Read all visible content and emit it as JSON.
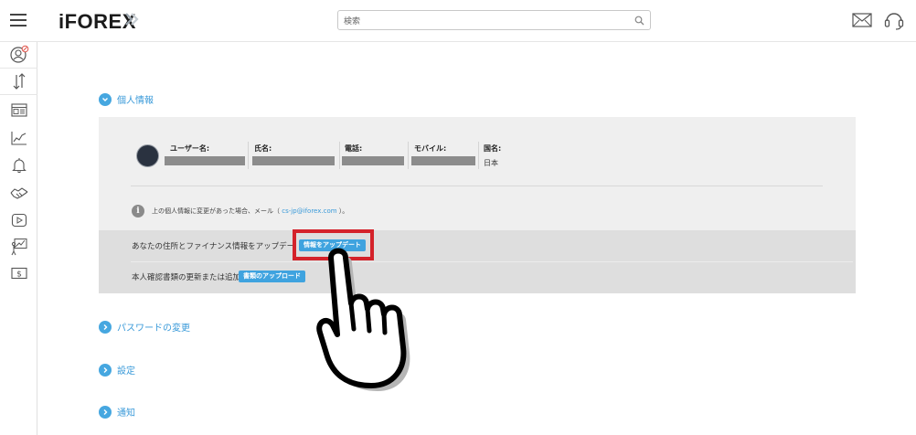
{
  "header": {
    "logo": "iFOREX",
    "search_placeholder": "検索",
    "icons": [
      "menu-icon",
      "search-icon",
      "mail-icon",
      "support-headset-icon"
    ]
  },
  "sidebar": {
    "icons": [
      "profile-icon",
      "transfer-icon",
      "news-icon",
      "chart-icon",
      "bell-icon",
      "handshake-icon",
      "play-icon",
      "strategy-icon",
      "dollar-icon"
    ]
  },
  "personal": {
    "section_title": "個人情報",
    "fields": {
      "username_label": "ユーザー名:",
      "name_label": "氏名:",
      "phone_label": "電話:",
      "mobile_label": "モバイル:",
      "country_label": "国名:",
      "country_value": "日本"
    },
    "notice_prefix": "上の個人情報に変更があった場合、メール（ ",
    "notice_email": "cs-jp@iforex.com",
    "notice_suffix": " ）。",
    "address_text": "あなたの住所とファイナンス情報をアップデー",
    "update_button": "情報をアップデート",
    "documents_text": "本人確認書類の更新または追加",
    "upload_button": "書類のアップロード"
  },
  "sections": {
    "password": "パスワードの変更",
    "settings": "設定",
    "notifications": "通知"
  },
  "colors": {
    "accent": "#3a9ad9",
    "button": "#3fa3df",
    "highlight": "#d4222a",
    "panel": "#efefef",
    "panel_dark": "#dedede"
  }
}
